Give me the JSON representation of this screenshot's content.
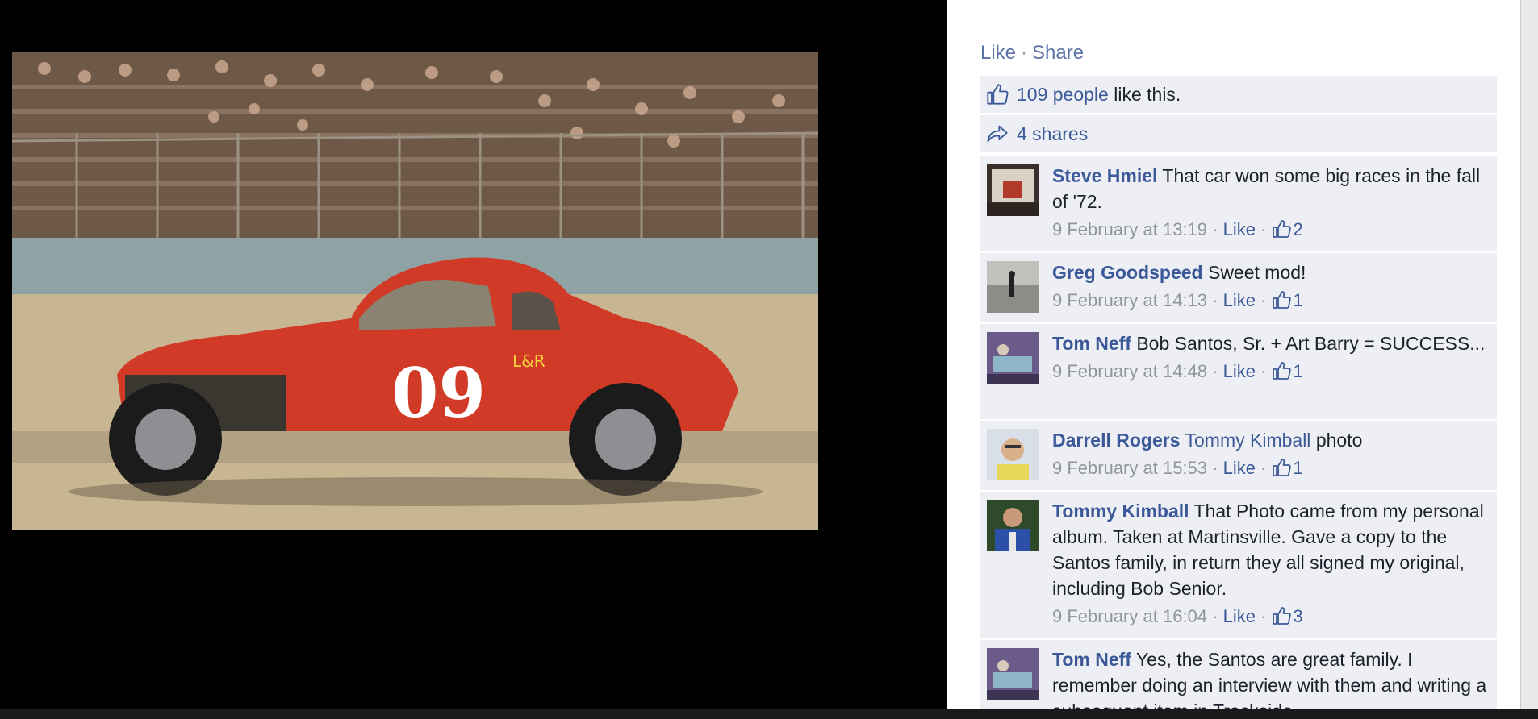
{
  "actions": {
    "like": "Like",
    "separator": "·",
    "share": "Share"
  },
  "likes": {
    "count_text": "109 people",
    "suffix": " like this."
  },
  "shares": {
    "text": "4 shares"
  },
  "photo": {
    "car_number": "09",
    "door_text": "L&R"
  },
  "comments": [
    {
      "author": "Steve Hmiel",
      "text": "That car won some big races in the fall of '72.",
      "time": "9 February at 13:19",
      "like": "Like",
      "likes": "2"
    },
    {
      "author": "Greg Goodspeed",
      "text": "Sweet mod!",
      "time": "9 February at 14:13",
      "like": "Like",
      "likes": "1"
    },
    {
      "author": "Tom Neff",
      "text": "Bob Santos, Sr. + Art Barry = SUCCESS...",
      "time": "9 February at 14:48",
      "like": "Like",
      "likes": "1"
    },
    {
      "author": "Darrell Rogers",
      "mention": "Tommy Kimball",
      "text": "photo",
      "time": "9 February at 15:53",
      "like": "Like",
      "likes": "1"
    },
    {
      "author": "Tommy Kimball",
      "text": "That Photo came from my personal album. Taken at Martinsville. Gave a copy to the Santos family, in return they all signed my original, including Bob Senior.",
      "time": "9 February at 16:04",
      "like": "Like",
      "likes": "3"
    },
    {
      "author": "Tom Neff",
      "text": "Yes, the Santos are great family. I remember doing an interview with them and writing a subsequent item in Trackside..."
    }
  ],
  "meta_separator": " · "
}
